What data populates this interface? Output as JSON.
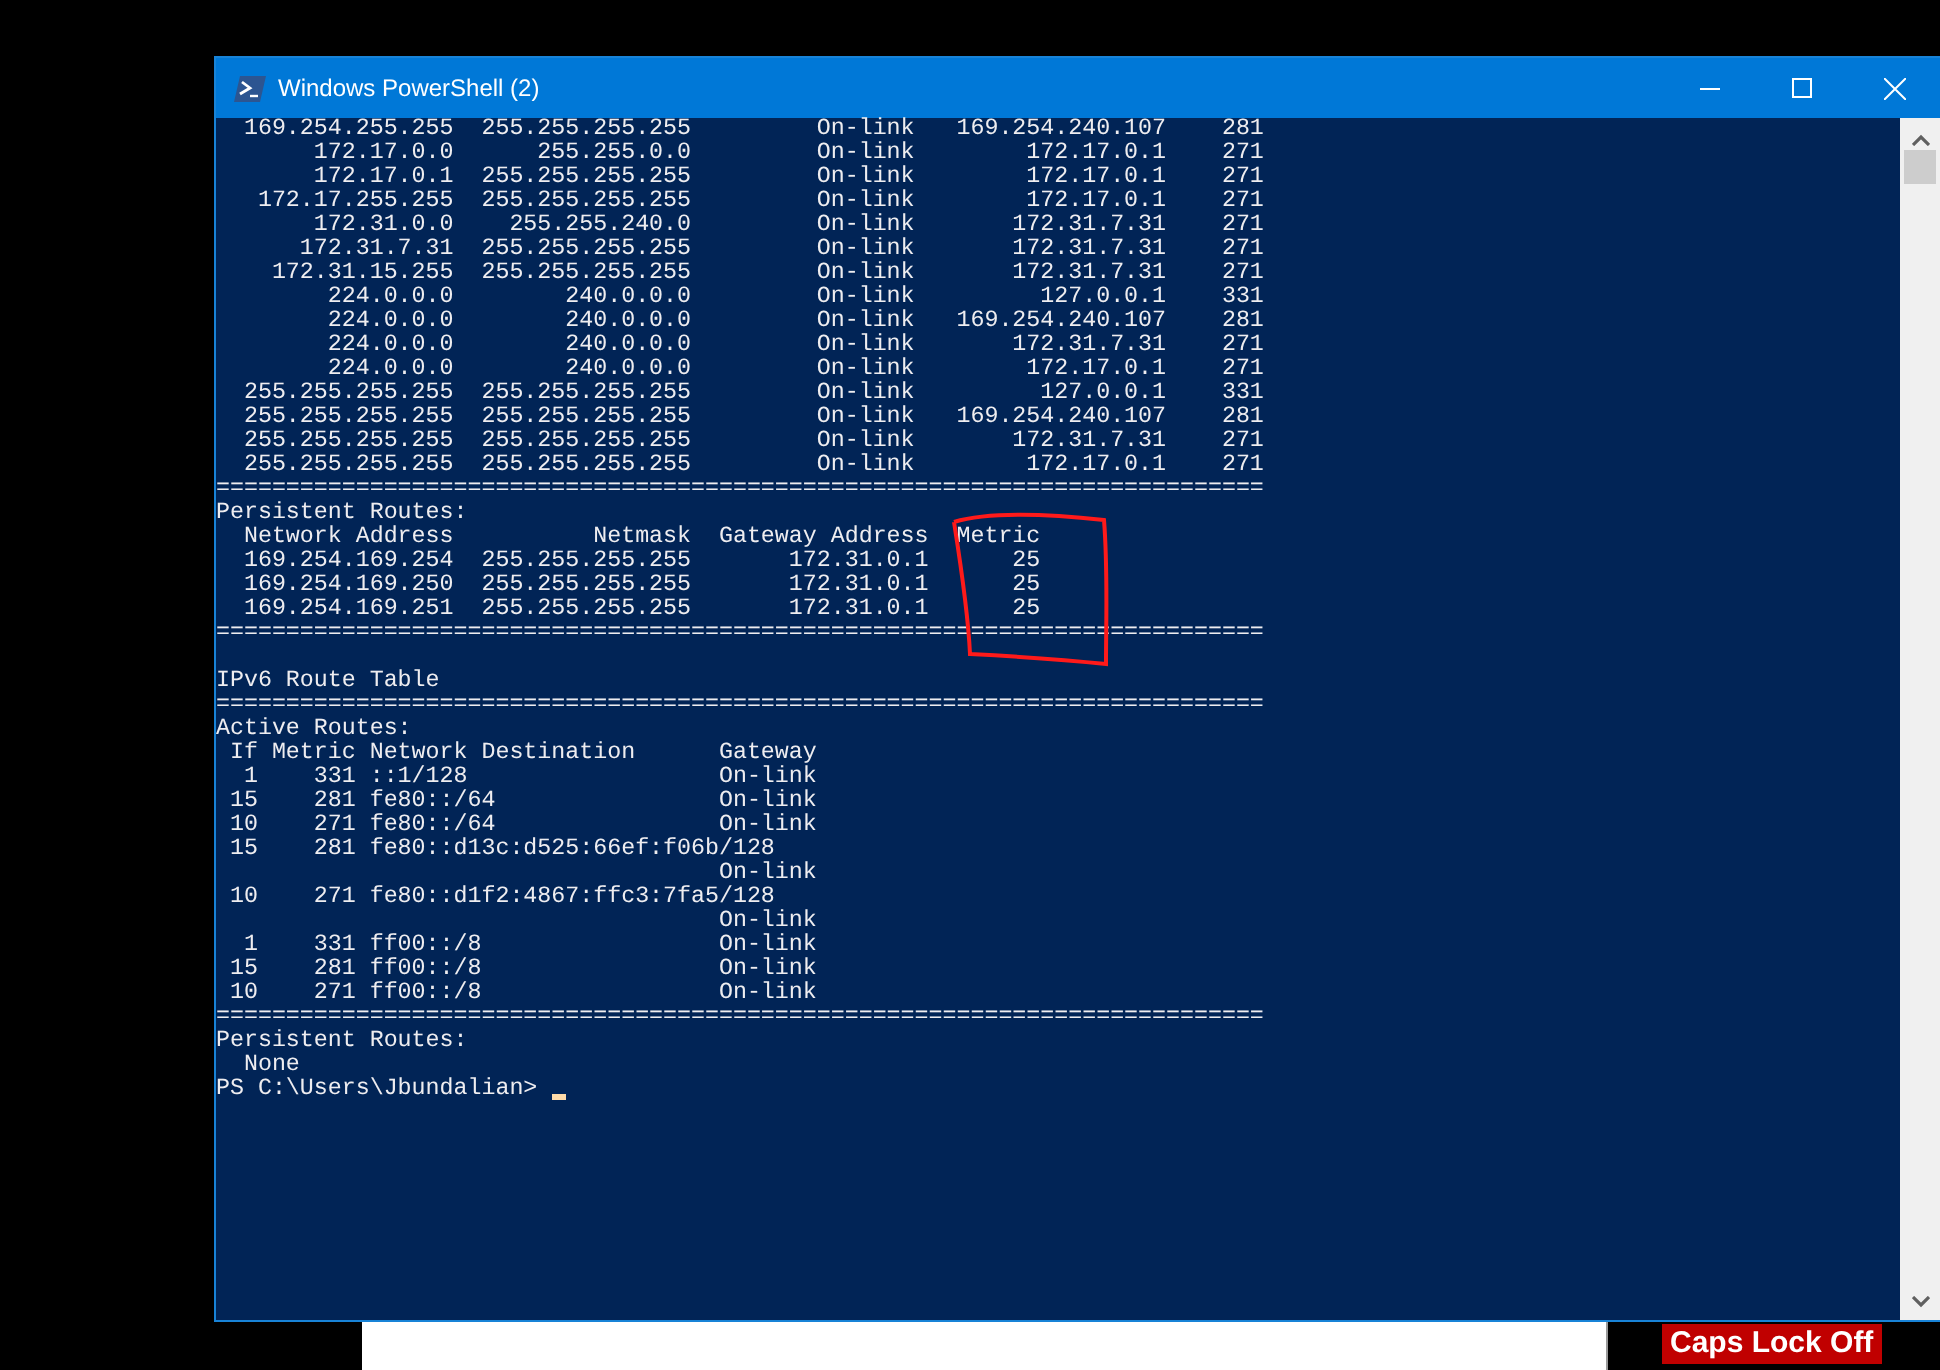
{
  "window": {
    "title": "Windows PowerShell (2)"
  },
  "console": [
    {
      "kind": "route4",
      "destination": "169.254.255.255",
      "netmask": "255.255.255.255",
      "gateway": "On-link",
      "interface": "169.254.240.107",
      "metric": "281"
    },
    {
      "kind": "route4",
      "destination": "172.17.0.0",
      "netmask": "255.255.0.0",
      "gateway": "On-link",
      "interface": "172.17.0.1",
      "metric": "271"
    },
    {
      "kind": "route4",
      "destination": "172.17.0.1",
      "netmask": "255.255.255.255",
      "gateway": "On-link",
      "interface": "172.17.0.1",
      "metric": "271"
    },
    {
      "kind": "route4",
      "destination": "172.17.255.255",
      "netmask": "255.255.255.255",
      "gateway": "On-link",
      "interface": "172.17.0.1",
      "metric": "271"
    },
    {
      "kind": "route4",
      "destination": "172.31.0.0",
      "netmask": "255.255.240.0",
      "gateway": "On-link",
      "interface": "172.31.7.31",
      "metric": "271"
    },
    {
      "kind": "route4",
      "destination": "172.31.7.31",
      "netmask": "255.255.255.255",
      "gateway": "On-link",
      "interface": "172.31.7.31",
      "metric": "271"
    },
    {
      "kind": "route4",
      "destination": "172.31.15.255",
      "netmask": "255.255.255.255",
      "gateway": "On-link",
      "interface": "172.31.7.31",
      "metric": "271"
    },
    {
      "kind": "route4",
      "destination": "224.0.0.0",
      "netmask": "240.0.0.0",
      "gateway": "On-link",
      "interface": "127.0.0.1",
      "metric": "331"
    },
    {
      "kind": "route4",
      "destination": "224.0.0.0",
      "netmask": "240.0.0.0",
      "gateway": "On-link",
      "interface": "169.254.240.107",
      "metric": "281"
    },
    {
      "kind": "route4",
      "destination": "224.0.0.0",
      "netmask": "240.0.0.0",
      "gateway": "On-link",
      "interface": "172.31.7.31",
      "metric": "271"
    },
    {
      "kind": "route4",
      "destination": "224.0.0.0",
      "netmask": "240.0.0.0",
      "gateway": "On-link",
      "interface": "172.17.0.1",
      "metric": "271"
    },
    {
      "kind": "route4",
      "destination": "255.255.255.255",
      "netmask": "255.255.255.255",
      "gateway": "On-link",
      "interface": "127.0.0.1",
      "metric": "331"
    },
    {
      "kind": "route4",
      "destination": "255.255.255.255",
      "netmask": "255.255.255.255",
      "gateway": "On-link",
      "interface": "169.254.240.107",
      "metric": "281"
    },
    {
      "kind": "route4",
      "destination": "255.255.255.255",
      "netmask": "255.255.255.255",
      "gateway": "On-link",
      "interface": "172.31.7.31",
      "metric": "271"
    },
    {
      "kind": "route4",
      "destination": "255.255.255.255",
      "netmask": "255.255.255.255",
      "gateway": "On-link",
      "interface": "172.17.0.1",
      "metric": "271"
    },
    {
      "kind": "text",
      "text": "==========================================================================="
    },
    {
      "kind": "text",
      "text": "Persistent Routes:"
    },
    {
      "kind": "persistent_header",
      "address": "Network Address",
      "netmask": "Netmask",
      "gateway": "Gateway Address",
      "metric": "Metric"
    },
    {
      "kind": "persistent",
      "address": "169.254.169.254",
      "netmask": "255.255.255.255",
      "gateway": "172.31.0.1",
      "metric": "25"
    },
    {
      "kind": "persistent",
      "address": "169.254.169.250",
      "netmask": "255.255.255.255",
      "gateway": "172.31.0.1",
      "metric": "25"
    },
    {
      "kind": "persistent",
      "address": "169.254.169.251",
      "netmask": "255.255.255.255",
      "gateway": "172.31.0.1",
      "metric": "25"
    },
    {
      "kind": "text",
      "text": "==========================================================================="
    },
    {
      "kind": "blank"
    },
    {
      "kind": "text",
      "text": "IPv6 Route Table"
    },
    {
      "kind": "text",
      "text": "==========================================================================="
    },
    {
      "kind": "text",
      "text": "Active Routes:"
    },
    {
      "kind": "route6_header",
      "interface": "If",
      "metric": "Metric",
      "destination": "Network Destination",
      "gateway": "Gateway"
    },
    {
      "kind": "route6",
      "interface": "1",
      "metric": "331",
      "destination": "::1/128",
      "gateway": "On-link",
      "gateway_on_next_line": false
    },
    {
      "kind": "route6",
      "interface": "15",
      "metric": "281",
      "destination": "fe80::/64",
      "gateway": "On-link",
      "gateway_on_next_line": false
    },
    {
      "kind": "route6",
      "interface": "10",
      "metric": "271",
      "destination": "fe80::/64",
      "gateway": "On-link",
      "gateway_on_next_line": false
    },
    {
      "kind": "route6",
      "interface": "15",
      "metric": "281",
      "destination": "fe80::d13c:d525:66ef:f06b/128",
      "gateway": "On-link",
      "gateway_on_next_line": true
    },
    {
      "kind": "route6",
      "interface": "10",
      "metric": "271",
      "destination": "fe80::d1f2:4867:ffc3:7fa5/128",
      "gateway": "On-link",
      "gateway_on_next_line": true
    },
    {
      "kind": "route6",
      "interface": "1",
      "metric": "331",
      "destination": "ff00::/8",
      "gateway": "On-link",
      "gateway_on_next_line": false
    },
    {
      "kind": "route6",
      "interface": "15",
      "metric": "281",
      "destination": "ff00::/8",
      "gateway": "On-link",
      "gateway_on_next_line": false
    },
    {
      "kind": "route6",
      "interface": "10",
      "metric": "271",
      "destination": "ff00::/8",
      "gateway": "On-link",
      "gateway_on_next_line": false
    },
    {
      "kind": "text",
      "text": "==========================================================================="
    },
    {
      "kind": "text",
      "text": "Persistent Routes:"
    },
    {
      "kind": "indented",
      "text": "None"
    },
    {
      "kind": "prompt",
      "text": "PS C:\\Users\\Jbundalian>"
    }
  ],
  "background": {
    "caps_indicator": "Caps Lock Off"
  }
}
